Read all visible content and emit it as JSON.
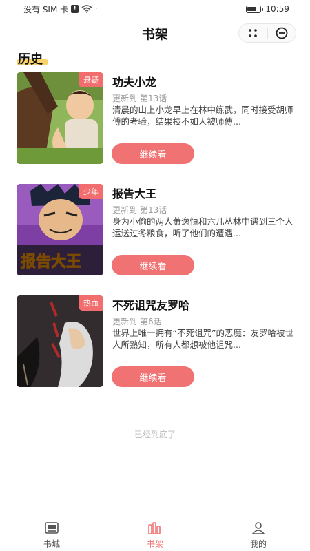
{
  "status_bar": {
    "carrier": "没有 SIM 卡",
    "sim_alert": "!",
    "time": "10:59",
    "battery_level": 0.75
  },
  "header": {
    "title": "书架",
    "capsule_icons": [
      "more-dots-icon",
      "close-circle-icon"
    ]
  },
  "section": {
    "title": "历史"
  },
  "books": [
    {
      "tag": "悬疑",
      "title": "功夫小龙",
      "update_prefix": "更新到",
      "chapter": "第13话",
      "desc": "清晨的山上小龙早上在林中练武，同时接受胡师傅的考验，结果技不如人被师傅...",
      "button": "继续看"
    },
    {
      "tag": "少年",
      "title": "报告大王",
      "update_prefix": "更新到",
      "chapter": "第13话",
      "desc": "身为小偷的两人萧逸恒和六儿丛林中遇到三个人运送过冬粮食，听了他们的遭遇...",
      "button": "继续看"
    },
    {
      "tag": "热血",
      "title": "不死诅咒友罗哈",
      "update_prefix": "更新到",
      "chapter": "第6话",
      "desc": "世界上唯一拥有“不死诅咒”的恶魔：友罗哈被世人所熟知，所有人都想被他诅咒...",
      "button": "继续看"
    }
  ],
  "footer": {
    "end_text": "已经到底了"
  },
  "tab_bar": {
    "tabs": [
      {
        "label": "书城",
        "icon": "book-city-icon",
        "active": false
      },
      {
        "label": "书架",
        "icon": "bookshelf-icon",
        "active": true
      },
      {
        "label": "我的",
        "icon": "profile-icon",
        "active": false
      }
    ],
    "active_color": "#f07272"
  },
  "colors": {
    "accent": "#f07272",
    "section_highlight": "#f7d36a"
  }
}
